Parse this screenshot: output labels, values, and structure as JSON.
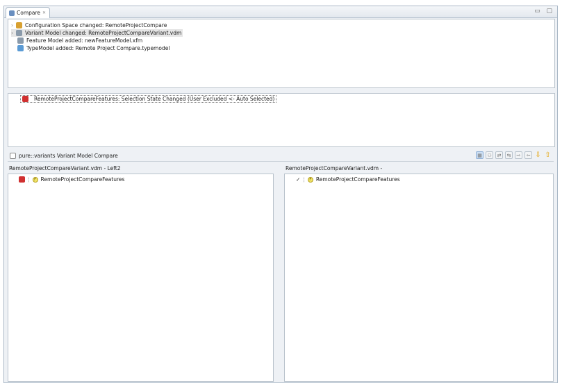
{
  "tab": {
    "label": "Compare",
    "close": "✕"
  },
  "window_controls": "▭ ▢",
  "changes": [
    {
      "label": "Configuration Space changed: RemoteProjectCompare",
      "expandable": true
    },
    {
      "label": "Variant Model  changed: RemoteProjectCompareVariant.vdm",
      "expandable": true,
      "selected": true
    },
    {
      "label": "Feature Model  added: newFeatureModel.xfm",
      "expandable": false
    },
    {
      "label": "TypeModel  added: Remote Project Compare.typemodel",
      "expandable": false
    }
  ],
  "detail": "RemoteProjectCompareFeatures: Selection State Changed (User Excluded <- Auto Selected)",
  "compare_title": "pure::variants Variant Model Compare",
  "left": {
    "header": "RemoteProjectCompareVariant.vdm - Left2",
    "item": "RemoteProjectCompareFeatures"
  },
  "right": {
    "header": "RemoteProjectCompareVariant.vdm -",
    "item": "RemoteProjectCompareFeatures",
    "check": "✓"
  },
  "feature_badge": "F"
}
